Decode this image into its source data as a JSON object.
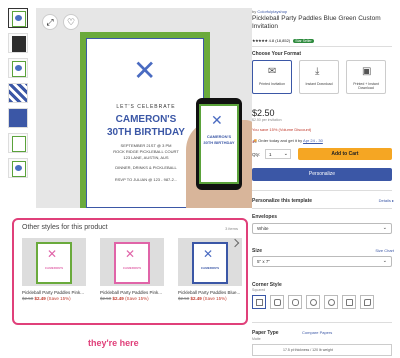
{
  "thumbnails": [
    {
      "name": "thumb-front",
      "style": "active"
    },
    {
      "name": "thumb-phone",
      "style": "dark"
    },
    {
      "name": "thumb-back",
      "style": "plain"
    },
    {
      "name": "thumb-pattern",
      "style": "pattern"
    },
    {
      "name": "thumb-blue",
      "style": "blue"
    },
    {
      "name": "thumb-detail-1",
      "style": "plain"
    },
    {
      "name": "thumb-detail-2",
      "style": "plain"
    }
  ],
  "invitation": {
    "celebrate": "LET'S CELEBRATE",
    "name": "CAMERON'S",
    "birthday": "30TH BIRTHDAY",
    "line1": "SEPTEMBER 21ST @ 3 PM",
    "line2": "ROCK RIDGE PICKLEBALL COURT",
    "line3": "123 LANE, AUSTIN, AUS",
    "line4": "DINNER, DRINKS & PICKLEBALL",
    "line5": "RSVP TO JULIAN @ 123 - 987-2...",
    "phone_name": "CAMERON'S",
    "phone_bday": "30TH BIRTHDAY"
  },
  "other_styles": {
    "title": "Other styles for this product",
    "count": "3 items",
    "items": [
      {
        "title": "Pickleball Party Paddles Pink...",
        "old_price": "$2.50",
        "new_price": "$2.49",
        "save": "(Save 15%)",
        "paddle_color": "#e064a8",
        "name": "CAMERON'S"
      },
      {
        "title": "Pickleball Party Paddles Pink...",
        "old_price": "$2.50",
        "new_price": "$2.49",
        "save": "(Save 15%)",
        "paddle_color": "#e064a8",
        "name": "CAMERON'S"
      },
      {
        "title": "Pickleball Party Paddles Blue...",
        "old_price": "$2.50",
        "new_price": "$2.49",
        "save": "(Save 15%)",
        "paddle_color": "#4a6bc1",
        "name": "CAMERON'S"
      }
    ]
  },
  "annotation": "they're here",
  "product": {
    "by_prefix": "by",
    "seller": "Colorfulplayshop",
    "title": "Pickleball Party Paddles Blue Green Custom Invitation",
    "stars": "★★★★★",
    "rating": "4.8 (18,852)",
    "badge": "Star Seller",
    "choose_format": "Choose Your Format",
    "formats": [
      {
        "label": "Printed Invitation",
        "icon": "✉"
      },
      {
        "label": "Instant Download",
        "icon": "⤓"
      },
      {
        "label": "Printed + Instant Download",
        "icon": "▣"
      }
    ],
    "price": "$2.50",
    "price_sub": "$2.50 per invitation",
    "sale": "You save 15% (Volume Discount)",
    "ship_prefix": "Order today and get it by",
    "ship_date": "Apr 24 - 30",
    "qty_label": "Qty:",
    "qty_value": "1",
    "add_to_cart": "Add to Cart",
    "personalize": "Personalize",
    "personalize_template": "Personalize this template",
    "details": "Details ▸",
    "envelopes_label": "Envelopes",
    "envelopes_value": "White",
    "size_label": "Size",
    "size_chart": "Size Chart",
    "size_value": "5\" x 7\"",
    "corner_label": "Corner Style",
    "corner_value": "Squared",
    "paper_label": "Paper Type",
    "compare_papers": "Compare Papers",
    "paper_value": "Matte",
    "paper_desc": "17.5 pt thickness / 120 lb weight"
  },
  "colors": {
    "accent": "#3b57a6",
    "green": "#6aaa3c",
    "annotation": "#e0407a",
    "cart": "#f5a623",
    "sale": "#c0392b"
  }
}
